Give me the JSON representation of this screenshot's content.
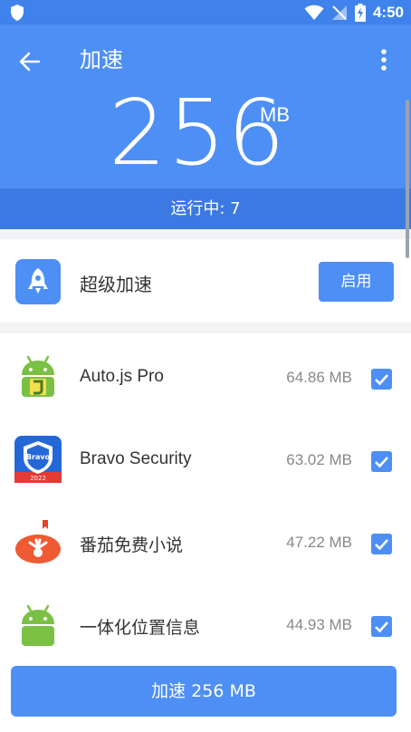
{
  "status_bar": {
    "time": "4:50"
  },
  "header": {
    "title": "加速",
    "memory_value": "256",
    "memory_unit": "MB",
    "running_label": "运行中: 7"
  },
  "super_boost": {
    "label": "超级加速",
    "button_label": "启用"
  },
  "apps": [
    {
      "name": "Auto.js Pro",
      "size": "64.86 MB",
      "checked": true,
      "icon": "autojs-android-icon"
    },
    {
      "name": "Bravo Security",
      "size": "63.02 MB",
      "checked": true,
      "icon": "bravo-shield-icon",
      "icon_text_top": "Bravo",
      "icon_text_bottom": "2022"
    },
    {
      "name": "番茄免费小说",
      "size": "47.22 MB",
      "checked": true,
      "icon": "tomato-icon"
    },
    {
      "name": "一体化位置信息",
      "size": "44.93 MB",
      "checked": true,
      "icon": "android-icon"
    }
  ],
  "bottom_button": {
    "label": "加速 256 MB"
  },
  "colors": {
    "accent": "#4d8ff5",
    "status_bar": "#3f82ec",
    "running_bar": "#3c79e3"
  }
}
